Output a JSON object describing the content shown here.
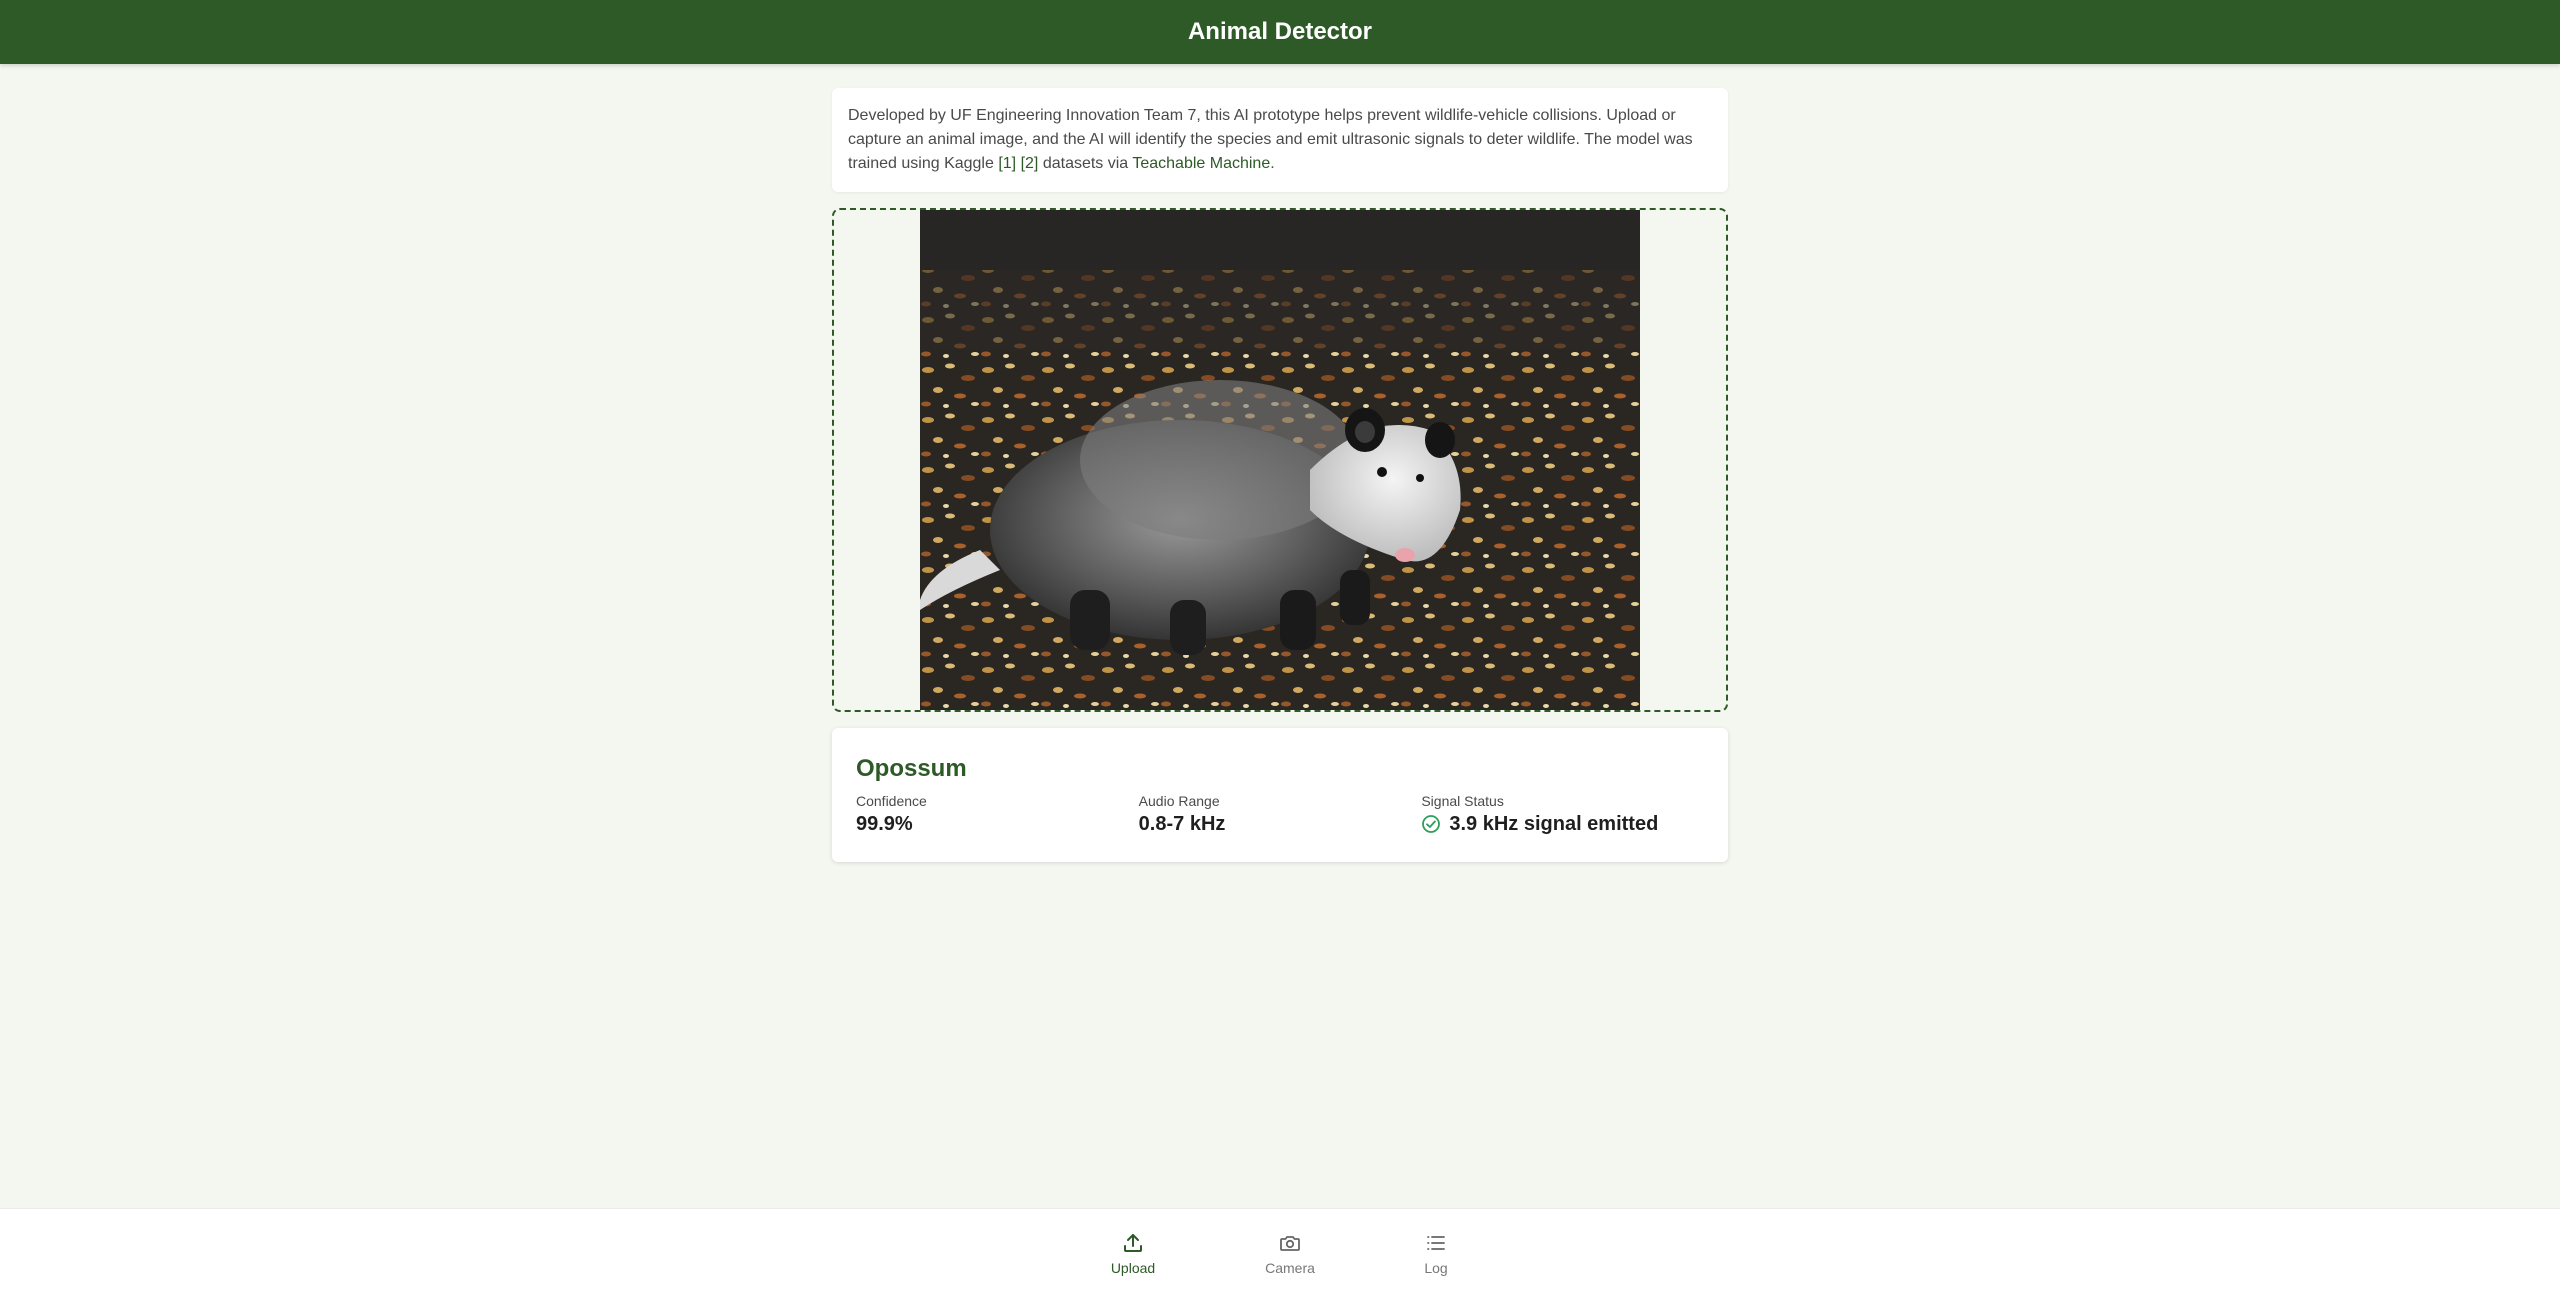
{
  "app": {
    "title": "Animal Detector"
  },
  "info": {
    "text_1": "Developed by UF Engineering Innovation Team 7, this AI prototype helps prevent wildlife-vehicle collisions. Upload or capture an animal image, and the AI will identify the species and emit ultrasonic signals to deter wildlife. The model was trained using Kaggle ",
    "link_1": "[1]",
    "link_2": "[2]",
    "text_2": " datasets via ",
    "link_3": "Teachable Machine",
    "text_3": "."
  },
  "result": {
    "species": "Opossum",
    "confidence_label": "Confidence",
    "confidence_value": "99.9%",
    "audio_label": "Audio Range",
    "audio_value": "0.8-7 kHz",
    "signal_label": "Signal Status",
    "signal_value": "3.9 kHz signal emitted"
  },
  "nav": {
    "items": [
      {
        "label": "Upload",
        "icon": "upload-icon",
        "active": true
      },
      {
        "label": "Camera",
        "icon": "camera-icon",
        "active": false
      },
      {
        "label": "Log",
        "icon": "list-icon",
        "active": false
      }
    ]
  },
  "colors": {
    "brand": "#2d5a27",
    "background": "#f4f6f0",
    "success": "#2e9e5b"
  }
}
